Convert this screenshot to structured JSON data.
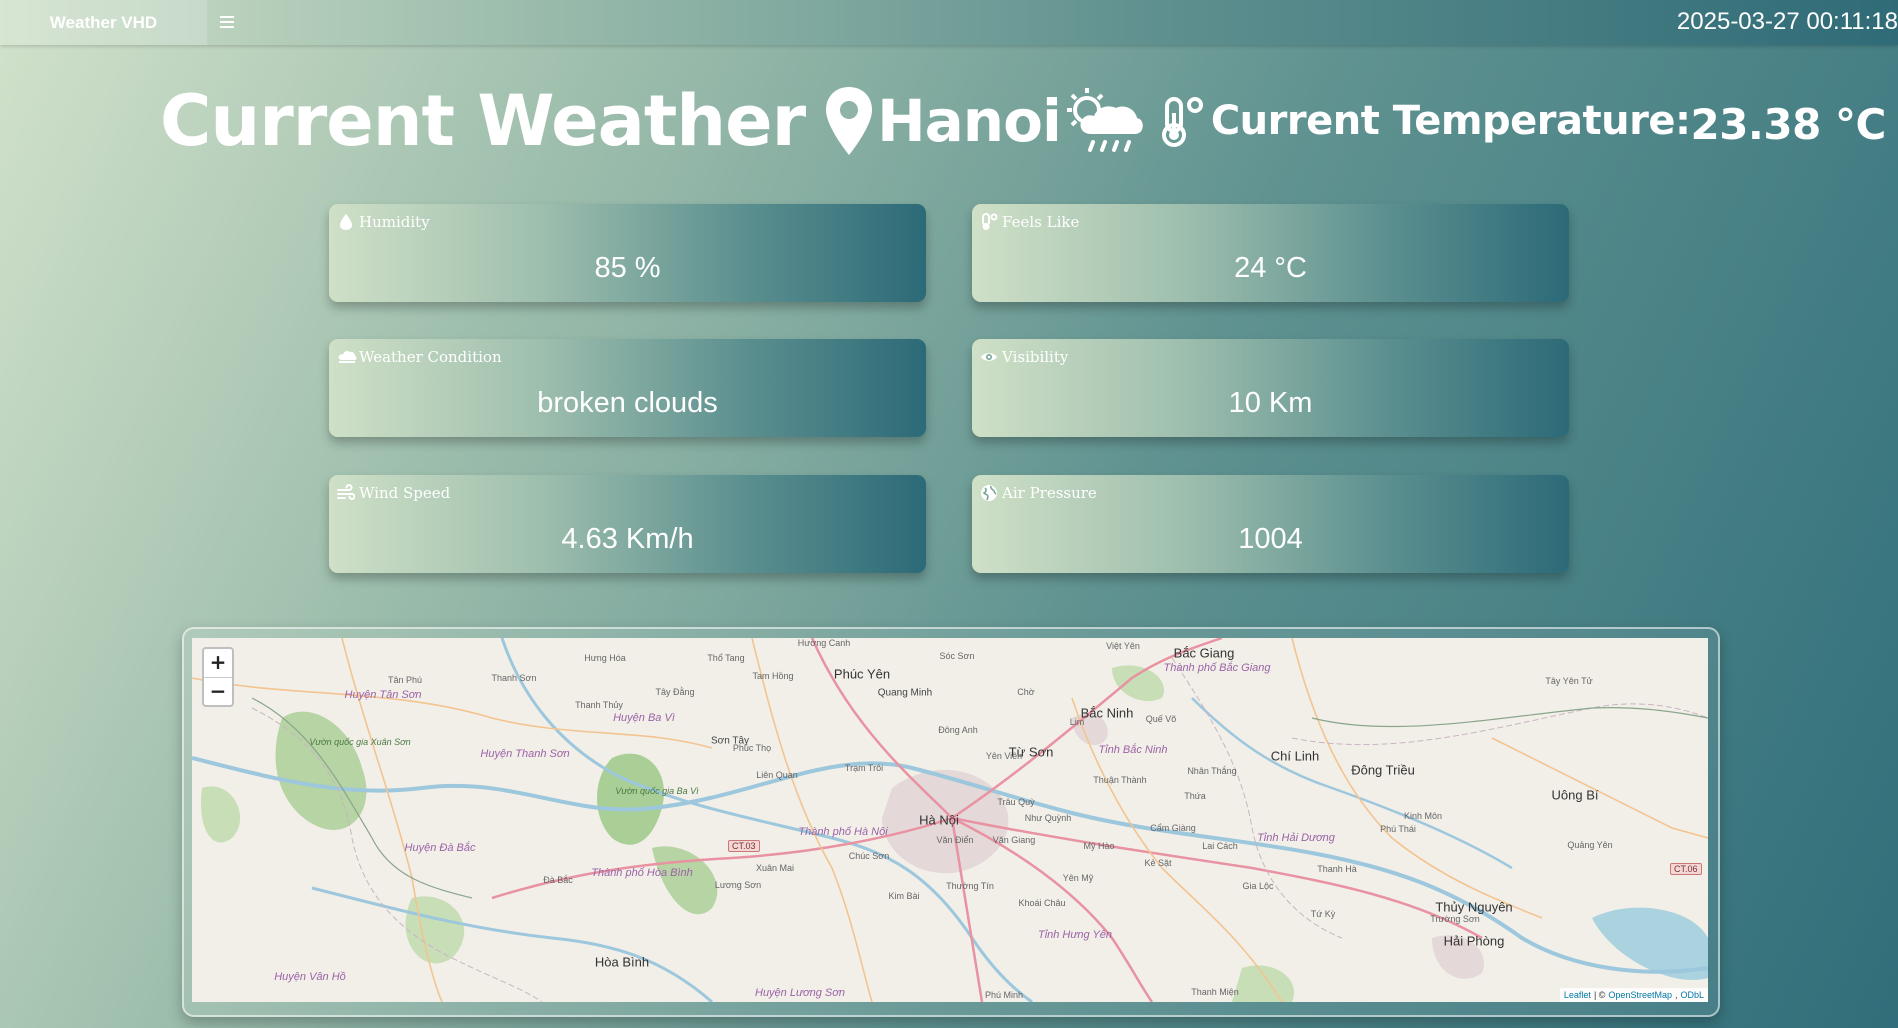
{
  "navbar": {
    "brand": "Weather VHD",
    "menu_icon": "hamburger-icon",
    "datetime": "2025-03-27 00:11:18"
  },
  "header": {
    "title": "Current Weather",
    "city": "Hanoi",
    "temp_label": "Current Temperature:",
    "temp_value": "23.38 °C",
    "icons": [
      "map-pin-icon",
      "sun-cloud-rain-icon",
      "thermometer-icon"
    ]
  },
  "cards": {
    "humidity": {
      "label": "Humidity",
      "value": "85 %",
      "icon": "droplet-icon"
    },
    "feels_like": {
      "label": "Feels Like",
      "value": "24 °C",
      "icon": "thermometer-icon"
    },
    "condition": {
      "label": "Weather Condition",
      "value": "broken clouds",
      "icon": "cloud-icon"
    },
    "visibility": {
      "label": "Visibility",
      "value": "10 Km",
      "icon": "eye-icon"
    },
    "wind": {
      "label": "Wind Speed",
      "value": "4.63 Km/h",
      "icon": "wind-icon"
    },
    "pressure": {
      "label": "Air Pressure",
      "value": "1004",
      "icon": "globe-icon"
    }
  },
  "map": {
    "zoom_in": "+",
    "zoom_out": "−",
    "attribution": {
      "leaflet": "Leaflet",
      "sep": "| ©",
      "osm": "OpenStreetMap",
      "odbl": "ODbL"
    },
    "places": {
      "hanoi": "Hà Nội",
      "bac_ninh": "Bắc Ninh",
      "bac_giang": "Bắc Giang",
      "phuc_yen": "Phúc Yên",
      "hai_phong": "Hải Phòng",
      "hoa_binh": "Hòa Bình",
      "chi_linh": "Chí Linh",
      "dong_trieu": "Đông Triều",
      "uong_bi": "Uông Bí",
      "thuy_nguyen": "Thủy Nguyên",
      "tu_son": "Từ Sơn",
      "son_tay": "Sơn Tây",
      "thanh_pho_ha_noi": "Thành phố Hà Nội",
      "tinh_bac_ninh": "Tỉnh Bắc Ninh",
      "tinh_hai_duong": "Tỉnh Hải Dương",
      "tinh_hung_yen": "Tỉnh Hưng Yên",
      "quang_minh": "Quang Minh",
      "soc_son": "Sóc Sơn",
      "dong_anh": "Đông Anh",
      "tram_troi": "Trạm Trôi",
      "lien_quan": "Liên Quan",
      "phuc_tho": "Phúc Thọ",
      "van_dien": "Văn Điển",
      "chuc_son": "Chúc Sơn",
      "xuan_mai": "Xuân Mai",
      "luong_son": "Lương Sơn",
      "da_bac": "Đà Bắc",
      "thuong_tin": "Thường Tín",
      "kim_bai": "Kim Bài",
      "khoai_chau": "Khoái Châu",
      "thuan_thanh": "Thuận Thành",
      "nhan_thang": "Nhân Thắng",
      "cam_giang": "Cẩm Giàng",
      "lai_cach": "Lai Cách",
      "ke_sat": "Kẻ Sặt",
      "gia_loc": "Gia Lộc",
      "thanh_ha": "Thanh Hà",
      "tu_ky": "Tứ Kỳ",
      "truong_son": "Trường Sơn",
      "kinh_mon": "Kinh Môn",
      "phu_thai": "Phú Thái",
      "quang_yen": "Quảng Yên",
      "thanh_thuy": "Thanh Thủy",
      "tay_dang": "Tây Đằng",
      "tam_hong": "Tam Hồng",
      "tho_tang": "Thổ Tang",
      "hung_hoa": "Hưng Hóa",
      "thanh_son": "Thanh Sơn",
      "tan_phu": "Tân Phú",
      "viet_yen": "Việt Yên",
      "cho": "Chờ",
      "lim": "Lim",
      "que_vo": "Quế Võ",
      "tay_yen_tu": "Tây Yên Tử",
      "my_hao": "Mỹ Hào",
      "van_giang": "Văn Giang",
      "yen_my": "Yên Mỹ",
      "nhu_quynh": "Như Quỳnh",
      "trau_quy": "Trâu Quỳ",
      "yen_vien": "Yên Viên",
      "thua": "Thứa",
      "phu_minh": "Phú Minh",
      "thanh_mien": "Thanh Miện",
      "huong_canh": "Hương Canh",
      "vuon_qg_xuan_son": "Vườn quốc gia Xuân Sơn",
      "vuon_qg_ba_vi": "Vườn quốc gia Ba Vì",
      "huyen_ba_vi": "Huyện Ba Vì",
      "huyen_thanh_son": "Huyện Thanh Sơn",
      "huyen_tan_son": "Huyện Tân Sơn",
      "huyen_da_bac": "Huyện Đà Bắc",
      "huyen_yen_the": "Thành phố Bắc Giang",
      "huyen_van_ho": "Huyện Vân Hồ",
      "huyen_luong_son": "Huyện Lương Sơn",
      "thanh_pho_hoa_binh": "Thành phố Hòa Bình"
    },
    "shields": [
      "CT.03",
      "CT.06"
    ]
  }
}
